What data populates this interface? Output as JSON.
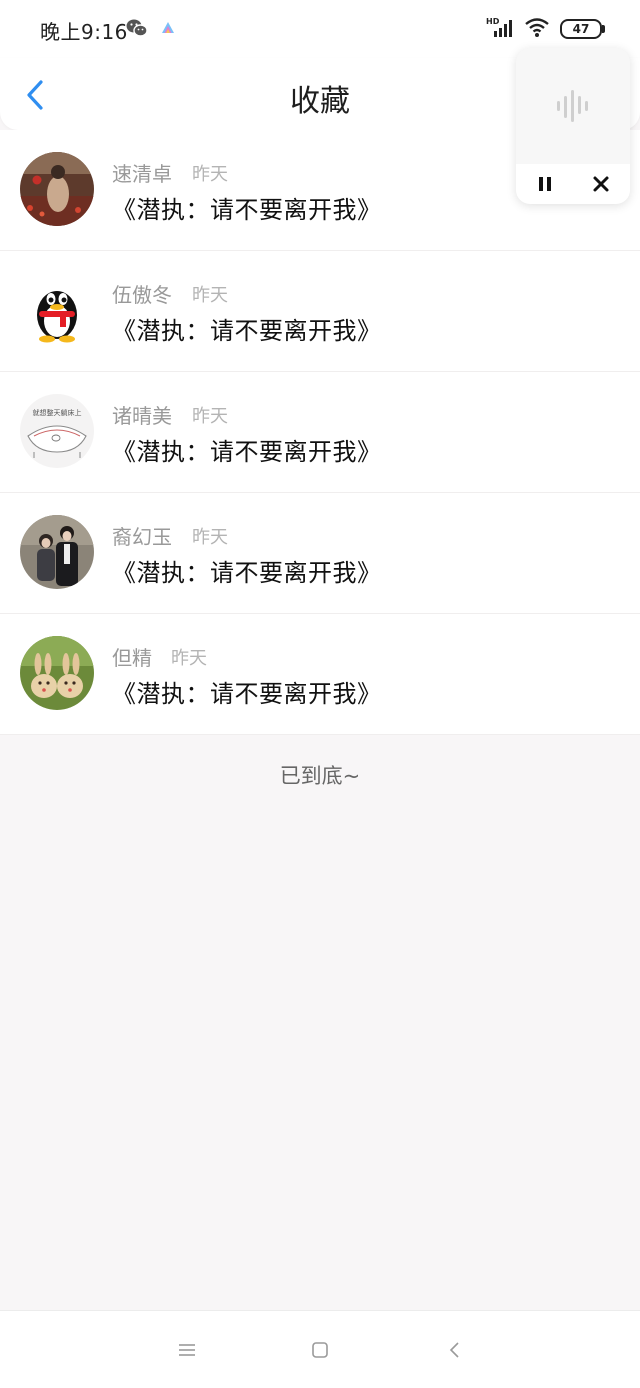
{
  "status_bar": {
    "time": "晚上9:16",
    "battery": "47",
    "network_badge": "HD"
  },
  "header": {
    "title": "收藏",
    "back_icon": "chevron-left-icon",
    "accent_color": "#2f8ef0"
  },
  "list": {
    "items": [
      {
        "name": "速清卓",
        "time": "昨天",
        "title": "《潜执：请不要离开我》",
        "avatar": "girl-in-field"
      },
      {
        "name": "伍傲冬",
        "time": "昨天",
        "title": "《潜执：请不要离开我》",
        "avatar": "qq-penguin"
      },
      {
        "name": "诸晴美",
        "time": "昨天",
        "title": "《潜执：请不要离开我》",
        "avatar": "sketch-bed",
        "avatar_caption": "就想整天躺床上"
      },
      {
        "name": "裔幻玉",
        "time": "昨天",
        "title": "《潜执：请不要离开我》",
        "avatar": "couple-photo"
      },
      {
        "name": "但精",
        "time": "昨天",
        "title": "《潜执：请不要离开我》",
        "avatar": "bunny-toys"
      }
    ],
    "end_text": "已到底~"
  },
  "voice_widget": {
    "wave_icon": "voice-wave-icon",
    "pause_icon": "pause-icon",
    "close_icon": "close-icon"
  },
  "nav_bar": {
    "menu_icon": "menu-icon",
    "home_icon": "home-square-icon",
    "back_icon": "back-triangle-icon"
  }
}
